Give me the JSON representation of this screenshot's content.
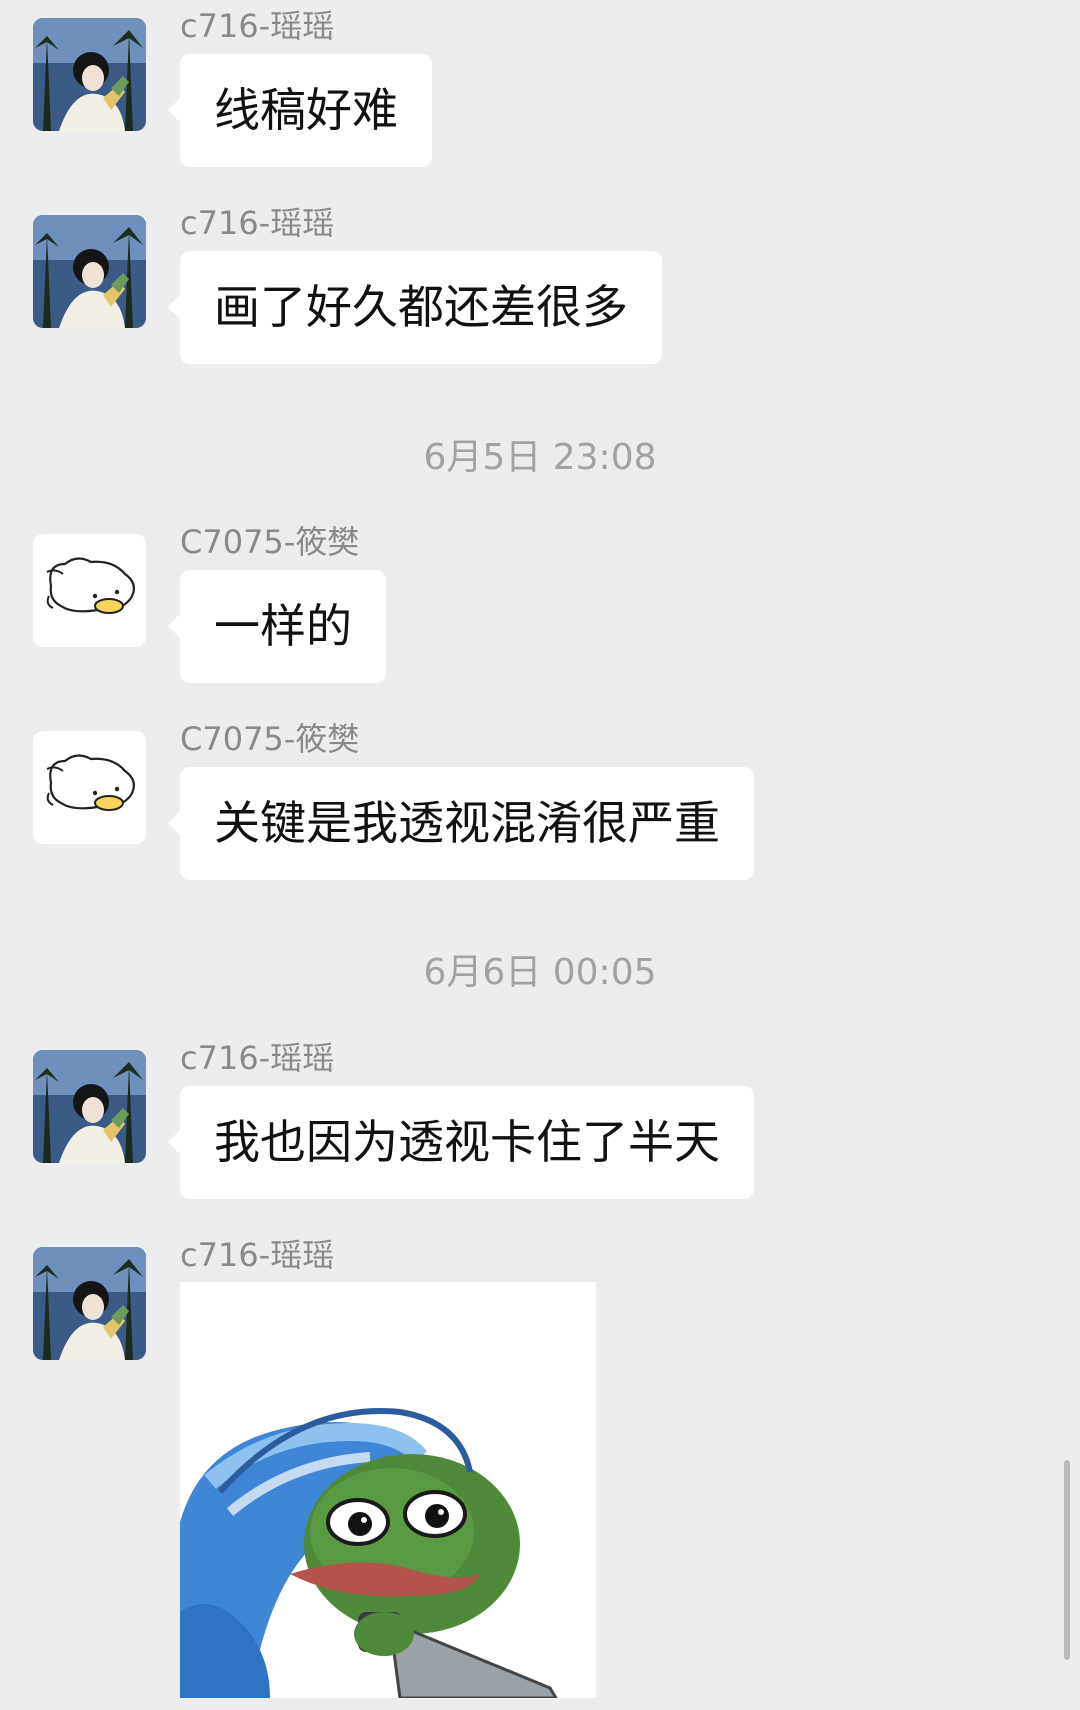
{
  "messages": [
    {
      "sender": "c716-瑶瑶",
      "text": "线稿好难",
      "avatar": "photo-avatar"
    },
    {
      "sender": "c716-瑶瑶",
      "text": "画了好久都还差很多",
      "avatar": "photo-avatar"
    },
    {
      "timestamp": "6月5日 23:08"
    },
    {
      "sender": "C7075-筱樊",
      "text": "一样的",
      "avatar": "duck-avatar"
    },
    {
      "sender": "C7075-筱樊",
      "text": "关键是我透视混淆很严重",
      "avatar": "duck-avatar"
    },
    {
      "timestamp": "6月6日 00:05"
    },
    {
      "sender": "c716-瑶瑶",
      "text": "我也因为透视卡住了半天",
      "avatar": "photo-avatar"
    },
    {
      "sender": "c716-瑶瑶",
      "sticker": "pepe-frog-blanket-sticker",
      "avatar": "photo-avatar"
    }
  ],
  "colors": {
    "background": "#ededed",
    "bubble": "#ffffff",
    "sender_text": "#8a8a8a",
    "timestamp_text": "#a2a2a2"
  }
}
